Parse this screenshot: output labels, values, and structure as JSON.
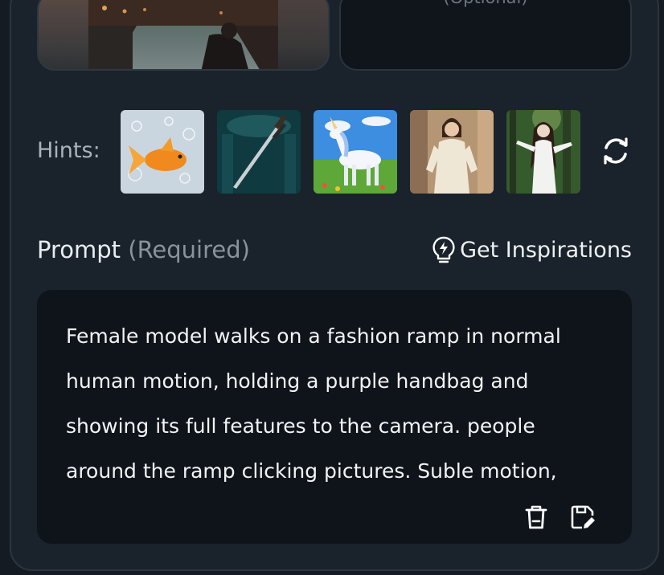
{
  "reference_image": {
    "optional_label": "(Optional)"
  },
  "hints": {
    "label": "Hints:",
    "items": [
      {
        "name": "hint-goldfish",
        "icon": "goldfish-image"
      },
      {
        "name": "hint-dagger",
        "icon": "dagger-image"
      },
      {
        "name": "hint-unicorn",
        "icon": "unicorn-image"
      },
      {
        "name": "hint-fashion-woman",
        "icon": "woman-image"
      },
      {
        "name": "hint-forest-woman",
        "icon": "forest-woman-image"
      }
    ],
    "refresh_icon": "refresh-icon"
  },
  "prompt": {
    "title": "Prompt",
    "required_label": "(Required)",
    "inspiration_label": "Get Inspirations",
    "text": "Female model walks on a fashion ramp in normal human motion, holding a purple handbag and showing its full features to the camera. people around the ramp clicking pictures. Suble motion,",
    "actions": [
      "delete-icon",
      "save-edit-icon"
    ]
  },
  "colors": {
    "background": "#151b22",
    "panel": "#1a222b",
    "input": "#0f141a",
    "text": "#e9edf2",
    "muted": "#8a939d"
  }
}
